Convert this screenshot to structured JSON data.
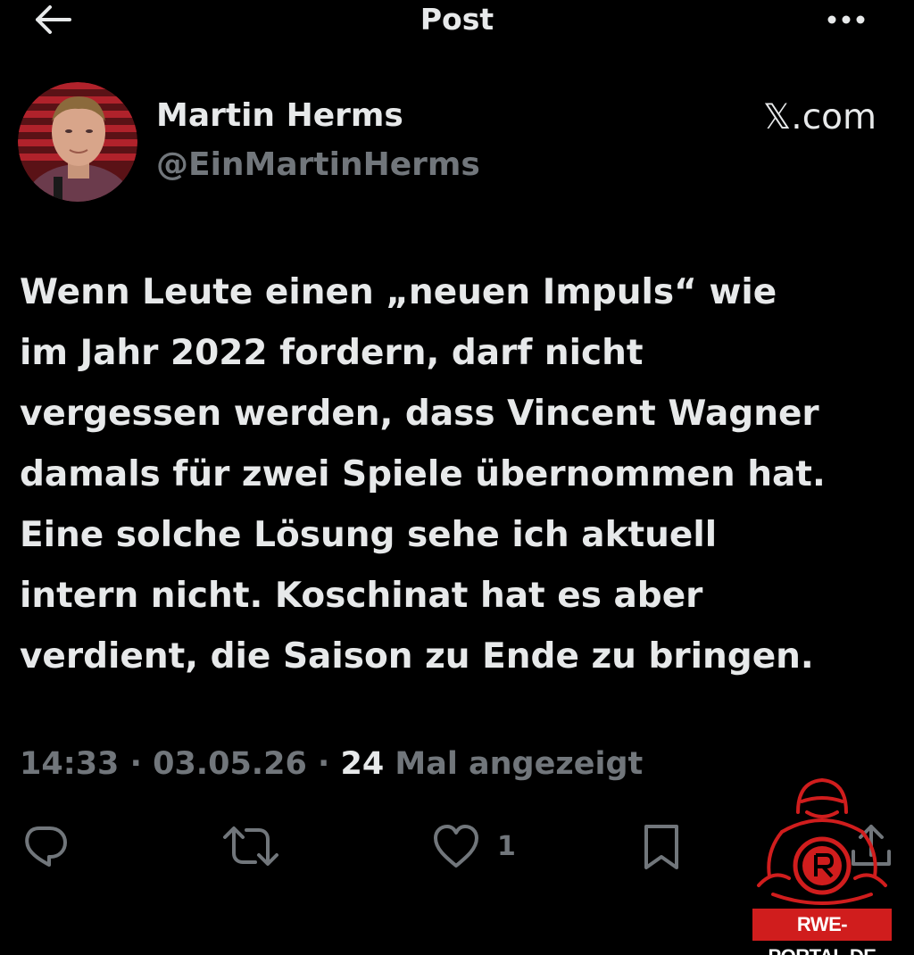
{
  "header": {
    "title": "Post",
    "back_icon": "arrow-left-icon",
    "more_icon": "more-horizontal-icon"
  },
  "author": {
    "name": "Martin Herms",
    "handle": "@EinMartinHerms",
    "source": "𝕏.com"
  },
  "tweet": {
    "lines": [
      "Wenn Leute einen „neuen Impuls“ wie",
      "im Jahr 2022 fordern, darf nicht",
      "vergessen werden, dass Vincent Wagner",
      "damals für zwei Spiele übernommen hat.",
      "Eine solche Lösung sehe ich aktuell",
      "intern nicht. Koschinat hat es aber",
      "verdient, die Saison zu Ende zu bringen."
    ]
  },
  "meta": {
    "time": "14:33",
    "separator": " · ",
    "date": "03.05.26",
    "views_count": "24",
    "views_label": " Mal angezeigt"
  },
  "actions": {
    "reply_icon": "reply-icon",
    "repost_icon": "repost-icon",
    "like_icon": "heart-icon",
    "like_count": "1",
    "bookmark_icon": "bookmark-icon",
    "share_icon": "share-icon"
  },
  "watermark": {
    "text": "RWE-PORTAL.DE"
  },
  "colors": {
    "background": "#000000",
    "primary_text": "#e7e9ea",
    "secondary_text": "#71767b",
    "watermark_red": "#d01d1d"
  }
}
